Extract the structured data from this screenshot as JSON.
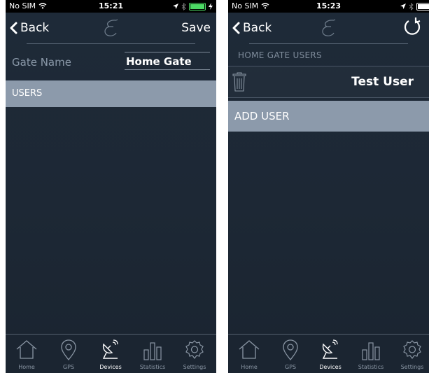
{
  "left_screen": {
    "status": {
      "carrier": "No SIM",
      "time": "15:21"
    },
    "nav": {
      "back_label": "Back",
      "save_label": "Save"
    },
    "gate_field": {
      "label": "Gate Name",
      "value": "Home Gate"
    },
    "section_label": "USERS",
    "tabs": [
      {
        "label": "Home",
        "icon": "home-icon",
        "active": false
      },
      {
        "label": "GPS",
        "icon": "gps-pin-icon",
        "active": false
      },
      {
        "label": "Devices",
        "icon": "satellite-dish-icon",
        "active": true
      },
      {
        "label": "Statistics",
        "icon": "bar-chart-icon",
        "active": false
      },
      {
        "label": "Settings",
        "icon": "gear-icon",
        "active": false
      }
    ]
  },
  "right_screen": {
    "status": {
      "carrier": "No SIM",
      "time": "15:23"
    },
    "nav": {
      "back_label": "Back"
    },
    "section_header": "HOME GATE USERS",
    "users": [
      {
        "name": "Test User"
      }
    ],
    "add_user_label": "ADD USER",
    "tabs": [
      {
        "label": "Home",
        "icon": "home-icon",
        "active": false
      },
      {
        "label": "GPS",
        "icon": "gps-pin-icon",
        "active": false
      },
      {
        "label": "Devices",
        "icon": "satellite-dish-icon",
        "active": true
      },
      {
        "label": "Statistics",
        "icon": "bar-chart-icon",
        "active": false
      },
      {
        "label": "Settings",
        "icon": "gear-icon",
        "active": false
      }
    ]
  },
  "colors": {
    "background": "#1e2a38",
    "highlight_bar": "#8c9aab",
    "label_gray": "#8a98a8",
    "battery_green": "#4cd964"
  }
}
